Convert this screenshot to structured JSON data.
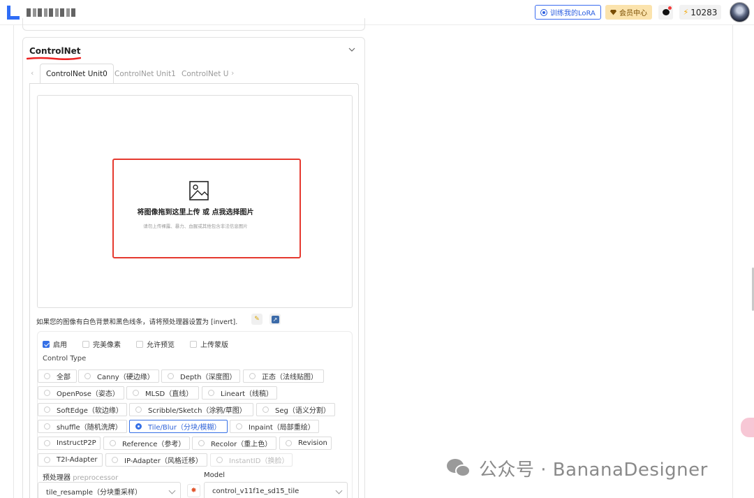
{
  "header": {
    "lora_button": "训练我的LoRA",
    "vip_button": "会员中心",
    "credits": "10283"
  },
  "panel": {
    "title": "ControlNet",
    "tabs": [
      "ControlNet Unit0",
      "ControlNet Unit1",
      "ControlNet U"
    ],
    "active_tab": 0
  },
  "upload": {
    "text": "将图像拖到这里上传 或 点我选择图片",
    "hint": "请勿上传裸露、暴力、血腥或其他包含非法信息图片"
  },
  "invert_note": "如果您的图像有白色背景和黑色线条，请将预处理器设置为 [invert].",
  "checkboxes": [
    {
      "label": "启用",
      "checked": true
    },
    {
      "label": "完美像素",
      "checked": false
    },
    {
      "label": "允许预览",
      "checked": false
    },
    {
      "label": "上传蒙版",
      "checked": false
    }
  ],
  "control_type": {
    "label": "Control Type",
    "options": [
      "全部",
      "Canny（硬边缘）",
      "Depth（深度图）",
      "正态（法线贴图）",
      "OpenPose（姿态）",
      "MLSD（直线）",
      "Lineart（线稿）",
      "SoftEdge（软边缘）",
      "Scribble/Sketch（涂鸦/草图）",
      "Seg（语义分割）",
      "shuffle（随机洗牌）",
      "Tile/Blur（分块/模糊）",
      "Inpaint（局部重绘）",
      "InstructP2P",
      "Reference（参考）",
      "Recolor（重上色）",
      "Revision",
      "T2I-Adapter",
      "IP-Adapter（风格迁移）",
      "InstantID（换脸）"
    ],
    "selected": "Tile/Blur（分块/模糊）"
  },
  "preprocessor": {
    "label": "预处理器",
    "label_en": "preprocessor",
    "value": "tile_resample（分块重采样）"
  },
  "model": {
    "label": "Model",
    "value": "control_v11f1e_sd15_tile"
  },
  "watermark": "公众号 · BananaDesigner"
}
